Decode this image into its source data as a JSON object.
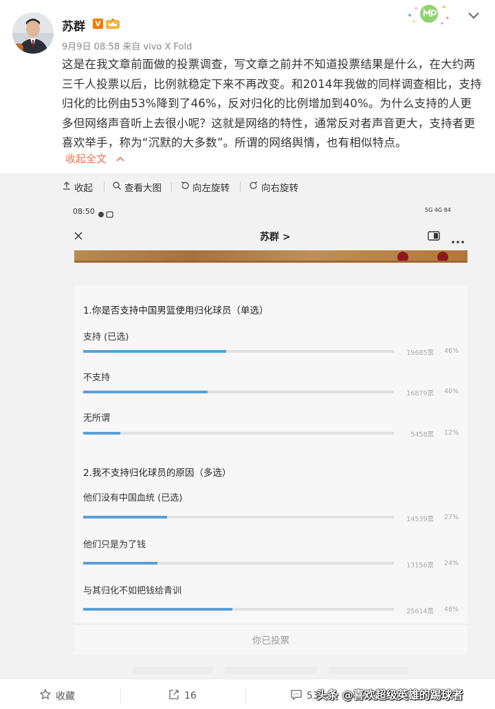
{
  "post": {
    "author": "苏群",
    "v_badge": "V",
    "meta": "9月9日 08:58 来自 vivo X Fold",
    "text": "这是在我文章前面做的投票调查，写文章之前并不知道投票结果是什么，在大约两三千人投票以后，比例就稳定下来不再改变。和2014年我做的同样调查相比，支持归化的比例由53%降到了46%，反对归化的比例增加到40%。为什么支持的人更多但网络声音听上去很小呢？这就是网络的特性，通常反对者声音更大，支持者更喜欢举手，称为“沉默的大多数”。所谓的网络舆情，也有相似特点。",
    "fold_label": "收起全文"
  },
  "viewer_toolbar": {
    "collapse": "收起",
    "view_large": "查看大图",
    "rotate_left": "向左旋转",
    "rotate_right": "向右旋转"
  },
  "screenshot": {
    "status_time": "08:50",
    "status_right": "5G 4G 84",
    "nav_title": "苏群 >",
    "poll": [
      {
        "title": "1.你是否支持中国男篮使用归化球员（单选）",
        "options": [
          {
            "label": "支持 (已选)",
            "votes": "19685票",
            "percent": "46%",
            "fill": 0.46
          },
          {
            "label": "不支持",
            "votes": "16879票",
            "percent": "40%",
            "fill": 0.4
          },
          {
            "label": "无所谓",
            "votes": "5458票",
            "percent": "12%",
            "fill": 0.12
          }
        ]
      },
      {
        "title": "2.我不支持归化球员的原因（多选）",
        "options": [
          {
            "label": "他们没有中国血统 (已选)",
            "votes": "14539票",
            "percent": "27%",
            "fill": 0.27
          },
          {
            "label": "他们只是为了钱",
            "votes": "13156票",
            "percent": "24%",
            "fill": 0.24
          },
          {
            "label": "与其归化不如把钱给青训",
            "votes": "25614票",
            "percent": "48%",
            "fill": 0.48
          }
        ]
      }
    ],
    "voted_label": "你已投票"
  },
  "footer": {
    "favorite": "收藏",
    "share_count": "16",
    "comment_count": "53",
    "watermark": "头条 @喜欢超级英雄的踢球者"
  },
  "colors": {
    "accent_link": "#eb7350",
    "bar_fill": "#5b9fd9",
    "bar_track": "#e1e1e1",
    "panel_bg": "#f2f2f2"
  }
}
